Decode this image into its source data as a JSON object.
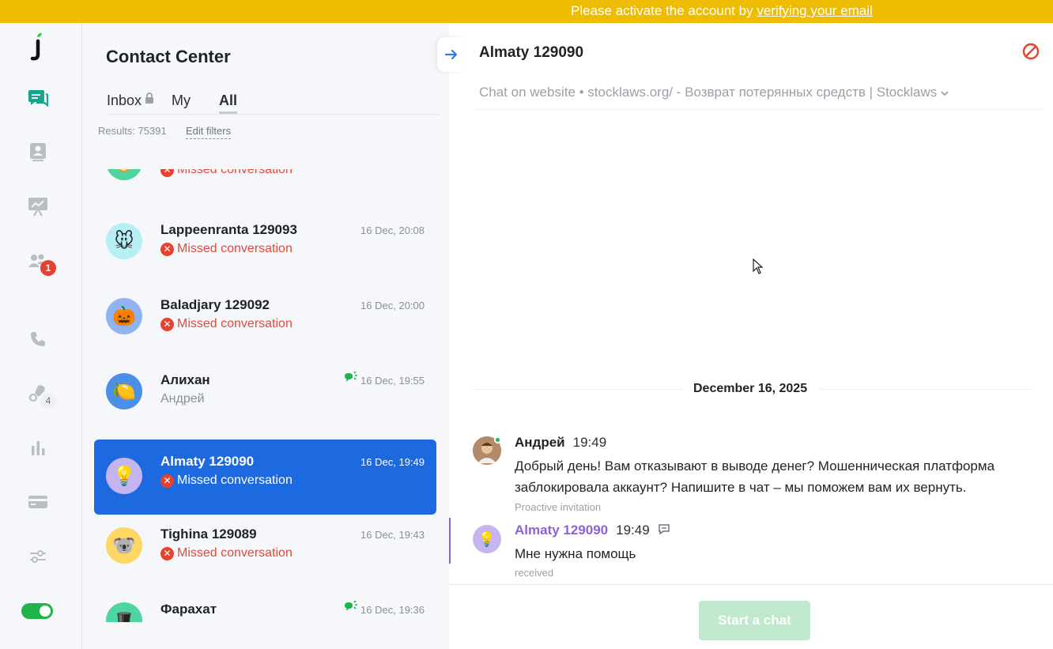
{
  "banner": {
    "prefix": "Please activate the account by ",
    "link": "verifying your email"
  },
  "colors": {
    "banner": "#efbd00",
    "accent_blue": "#1d69e0",
    "missed_red": "#e8412e",
    "online_green": "#1fb34a",
    "client_purple": "#8b62d9"
  },
  "rail": {
    "items": [
      {
        "icon": "logo-icon"
      },
      {
        "icon": "chats-icon"
      },
      {
        "icon": "contacts-icon"
      },
      {
        "icon": "reports-board-icon"
      },
      {
        "icon": "team-icon",
        "badge": "1"
      },
      {
        "icon": "phone-icon"
      },
      {
        "icon": "integrations-icon",
        "count": "4"
      },
      {
        "icon": "analytics-icon"
      },
      {
        "icon": "billing-card-icon"
      },
      {
        "icon": "settings-sliders-icon"
      },
      {
        "icon": "online-status-toggle"
      }
    ]
  },
  "list": {
    "title": "Contact Center",
    "tabs": [
      {
        "label": "Inbox",
        "locked": true
      },
      {
        "label": "My"
      },
      {
        "label": "All",
        "active": true
      }
    ],
    "results": "Results: 75391",
    "edit_filters": "Edit filters",
    "conversations": [
      {
        "name": "",
        "sub": "Missed conversation",
        "time": "",
        "missed": true,
        "avatar": "tiger-icon"
      },
      {
        "name": "Lappeenranta 129093",
        "sub": "Missed conversation",
        "time": "16 Dec, 20:08",
        "missed": true,
        "avatar": "mouse-icon"
      },
      {
        "name": "Baladjary 129092",
        "sub": "Missed conversation",
        "time": "16 Dec, 20:00",
        "missed": true,
        "avatar": "pumpkin-icon"
      },
      {
        "name": "Алихан",
        "sub": "Андрей",
        "time": "16 Dec, 19:55",
        "missed": false,
        "avatar": "lemon-icon"
      },
      {
        "name": "Almaty 129090",
        "sub": "Missed conversation",
        "time": "16 Dec, 19:49",
        "missed": true,
        "avatar": "lightbulb-icon",
        "selected": true
      },
      {
        "name": "Tighina 129089",
        "sub": "Missed conversation",
        "time": "16 Dec, 19:43",
        "missed": true,
        "avatar": "koala-icon"
      },
      {
        "name": "Фарахат",
        "sub": "",
        "time": "16 Dec, 19:36",
        "missed": false,
        "avatar": "hat-icon"
      }
    ]
  },
  "chat": {
    "title": "Almaty 129090",
    "source": "Chat on website • stocklaws.org/ - Возврат потерянных средств | Stocklaws",
    "date": "December 16, 2025",
    "messages": [
      {
        "author": "Андрей",
        "time": "19:49",
        "text": "Добрый день! Вам отказывают в выводе денег? Мошенническая платформа заблокировала аккаунт? Напишите в чат – мы поможем вам их вернуть.",
        "meta": "Proactive invitation"
      },
      {
        "author": "Almaty 129090",
        "time": "19:49",
        "text": "Мне нужна помощь",
        "meta": "received"
      }
    ],
    "start_button": "Start a chat"
  }
}
